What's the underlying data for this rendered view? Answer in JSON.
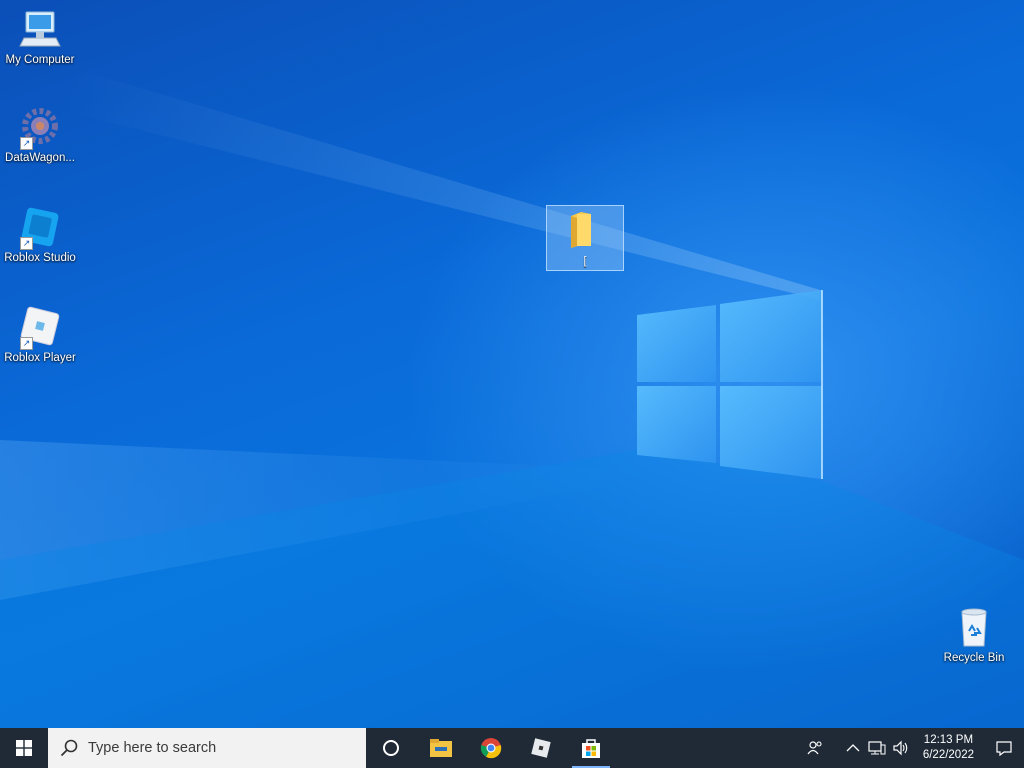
{
  "desktop": {
    "icons": [
      {
        "label": "My Computer",
        "icon": "computer-icon"
      },
      {
        "label": "DataWagon...",
        "icon": "gear-icon"
      },
      {
        "label": "Roblox Studio",
        "icon": "roblox-studio-icon"
      },
      {
        "label": "Roblox Player",
        "icon": "roblox-player-icon"
      }
    ],
    "selected_folder": {
      "label": "[",
      "icon": "folder-icon"
    },
    "recycle_bin": {
      "label": "Recycle Bin",
      "icon": "recycle-bin-icon"
    }
  },
  "taskbar": {
    "search_placeholder": "Type here to search",
    "apps": [
      "cortana-icon",
      "file-explorer-icon",
      "chrome-icon",
      "roblox-icon",
      "microsoft-store-icon"
    ],
    "tray_icons": [
      "people-icon",
      "chevron-up-icon",
      "network-icon",
      "volume-icon"
    ],
    "clock": {
      "time": "12:13 PM",
      "date": "6/22/2022"
    }
  },
  "colors": {
    "taskbar": "#1f2a36",
    "desktop": "#0a6ad8",
    "accent": "#7fb4ff"
  }
}
